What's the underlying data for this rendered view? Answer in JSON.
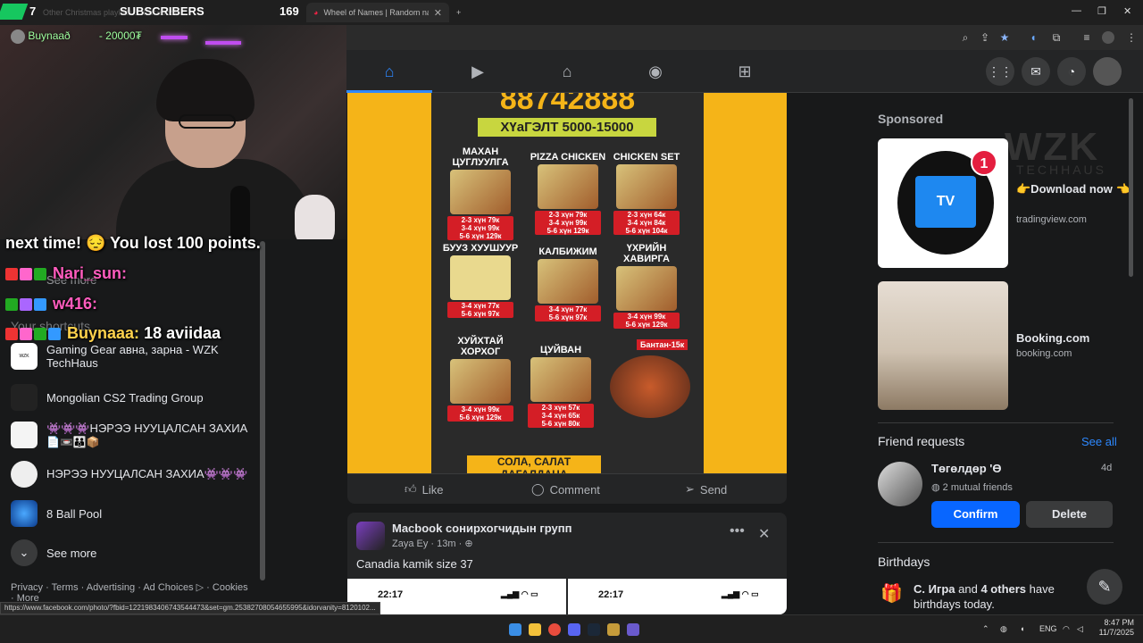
{
  "browser": {
    "tabs": [
      {
        "label": "Other Christmas playlists ... Facebook"
      },
      {
        "label": "Wheel of Names | Random name picker"
      }
    ],
    "new_tab": "+",
    "status_url": "https://www.facebook.com/photo/?fbid=1221983406743544473&set=gm.25382708054655995&idorvanity=8120102..."
  },
  "stream": {
    "subs_count": "7",
    "subs_label": "SUBSCRIBERS",
    "subs_value": "169",
    "donation": "Buynaað - 20000₮",
    "chat": [
      {
        "text": "next time! 😔 You lost 100 points."
      },
      {
        "user": "Nari_sun:",
        "msg": ""
      },
      {
        "user": "w416:",
        "msg": ""
      },
      {
        "user": "Buynaaa:",
        "msg": "18 aviidaa"
      }
    ]
  },
  "leftnav": {
    "see_more_top": "See more",
    "shortcuts_heading": "Your shortcuts",
    "items": [
      {
        "label": "Gaming Gear авна, зарна - WZK TechHaus",
        "thumb": "WZK TECHHAUS"
      },
      {
        "label": "Mongolian CS2 Trading Group"
      },
      {
        "label": "👾👾👾НЭРЭЭ НУУЦАЛСАН ЗАХИА",
        "sub": "📄📼👪📦"
      },
      {
        "label": "НЭРЭЭ НУУЦАЛСАН ЗАХИА👾👾👾"
      },
      {
        "label": "8 Ball Pool"
      }
    ],
    "see_more": "See more",
    "footer": "Privacy · Terms · Advertising · Ad Choices ▷ · Cookies · More"
  },
  "post1": {
    "poster_number": "88742888",
    "delivery": "ХҮaГЭЛТ 5000-15000",
    "dishes": [
      {
        "name": "МАХАН ЦУГЛУУЛГА",
        "prices": [
          "2-3 хүн 79к",
          "3-4 хүн 99к",
          "5-6 хүн 129к"
        ]
      },
      {
        "name": "PIZZA CHICKEN",
        "prices": [
          "2-3 хүн 79к",
          "3-4 хүн 99к",
          "5-6 хүн 129к"
        ]
      },
      {
        "name": "CHICKEN SET",
        "prices": [
          "2-3 хүн 64к",
          "3-4 хүн 84к",
          "5-6 хүн 104к"
        ]
      },
      {
        "name": "БУУЗ ХУУШУУР",
        "prices": [
          "3-4 хүн 77к",
          "5-6 хүн 97к"
        ]
      },
      {
        "name": "КАЛБИЖИМ",
        "prices": [
          "3-4 хүн 77к",
          "5-6 хүн 97к"
        ]
      },
      {
        "name": "ҮХРИЙН ХАВИРГА",
        "prices": [
          "3-4 хүн 99к",
          "5-6 хүн 129к"
        ]
      },
      {
        "name": "ХУЙХТАЙ ХОРХОГ",
        "prices": [
          "3-4 хүн 99к",
          "5-6 хүн 129к"
        ]
      },
      {
        "name": "ЦУЙВАН",
        "prices": [
          "2-3 хүн 57к",
          "3-4 хүн 65к",
          "5-6 хүн 80к"
        ]
      }
    ],
    "bantan": "Бантан-15к",
    "footer_text": "СОЛА, САЛАТ ДАГАЛДАНА",
    "like": "Like",
    "comment": "Comment",
    "send": "Send"
  },
  "post2": {
    "group": "Macbook сонирхогчидын групп",
    "author": "Zaya Ey",
    "time": "13m",
    "text": "Canadia kamik size 37",
    "shot_time_1": "22:17",
    "shot_time_2": "22:17"
  },
  "right": {
    "sponsored": "Sponsored",
    "ads": [
      {
        "title": "👉Download now 👈",
        "url": "tradingview.com",
        "badge": "1"
      },
      {
        "title": "Booking.com",
        "url": "booking.com"
      }
    ],
    "friend_requests": "Friend requests",
    "see_all": "See all",
    "request": {
      "name": "Төгөлдөр 'Ө",
      "age": "4d",
      "mutual": "2 mutual friends",
      "confirm": "Confirm",
      "delete": "Delete"
    },
    "birthdays": "Birthdays",
    "birthday_text_1": "С. Игра",
    "birthday_text_2": " and ",
    "birthday_text_3": "4 others",
    "birthday_text_4": " have birthdays today.",
    "watermark": "WZK",
    "watermark_sub": "TECHHAUS"
  },
  "taskbar": {
    "lang": "ENG",
    "time": "8:47 PM",
    "date": "11/7/2025"
  },
  "colors": {
    "fb_blue": "#2d88ff",
    "button_blue": "#0866ff",
    "poster_yellow": "#f5b418"
  }
}
